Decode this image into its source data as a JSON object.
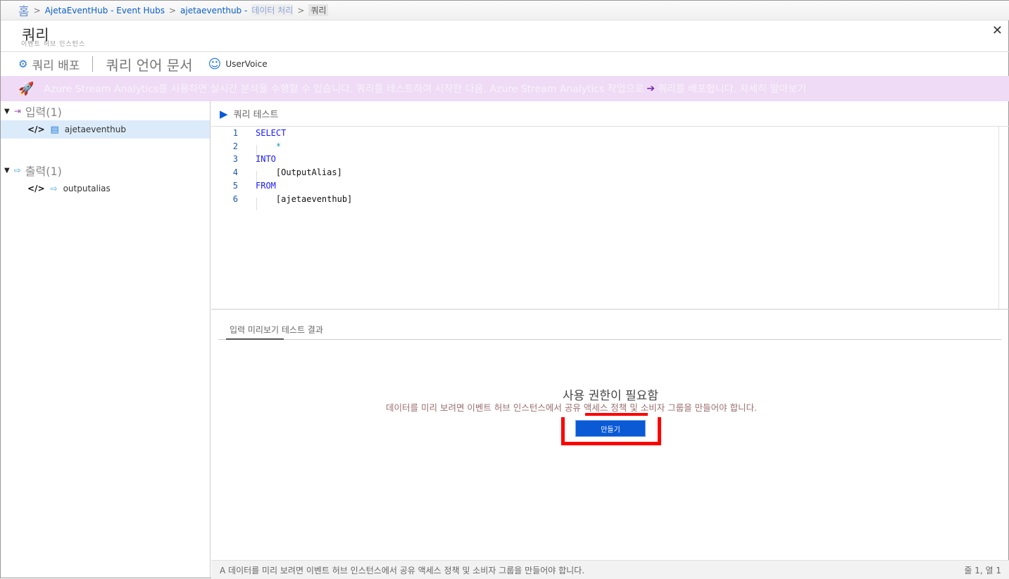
{
  "breadcrumb": {
    "home": "홈",
    "items": [
      "AjetaEventHub - Event Hubs",
      "ajetaeventhub -",
      "데이터 처리"
    ],
    "current": "쿼리"
  },
  "header": {
    "title": "쿼리",
    "subtitle": "이벤트 허브 인스턴스",
    "close": "✕"
  },
  "toolbar": {
    "deploy": "쿼리 배포",
    "docs": "쿼리 언어 문서",
    "uservoice": "UserVoice"
  },
  "banner": {
    "text": "Azure Stream Analytics를 사용하면 실시간 분석을 수행할 수 있습니다. 쿼리를 테스트하여 시작한 다음, Azure Stream Analytics 작업으로",
    "text2": "쿼리를 배포합니다. 자세히 알아보기"
  },
  "tree": {
    "inputs_label": "입력(1)",
    "input_item": "ajetaeventhub",
    "outputs_label": "출력(1)",
    "output_item": "outputalias"
  },
  "editor": {
    "test_label": "쿼리 테스트",
    "lines": [
      {
        "n": "1",
        "t": "SELECT",
        "kw": true
      },
      {
        "n": "2",
        "t": "    *",
        "kw": false
      },
      {
        "n": "3",
        "t": "INTO",
        "kw": true
      },
      {
        "n": "4",
        "t": "    [OutputAlias]",
        "kw": false
      },
      {
        "n": "5",
        "t": "FROM",
        "kw": true
      },
      {
        "n": "6",
        "t": "    [ajetaeventhub]",
        "kw": false
      }
    ]
  },
  "results": {
    "tab": "입력 미리보기 테스트 결과",
    "heading": "사용 권한이 필요함",
    "message": "데이터를 미리 보려면 이벤트 허브 인스턴스에서 공유 액세스 정책 및 소비자 그룹을 만들어야 합니다.",
    "create": "만들기"
  },
  "status": {
    "left": "A 데이터를 미리 보려면 이벤트 허브 인스턴스에서 공유 액세스 정책 및 소비자 그룹을 만들어야 합니다.",
    "right": "줄 1, 열 1"
  }
}
